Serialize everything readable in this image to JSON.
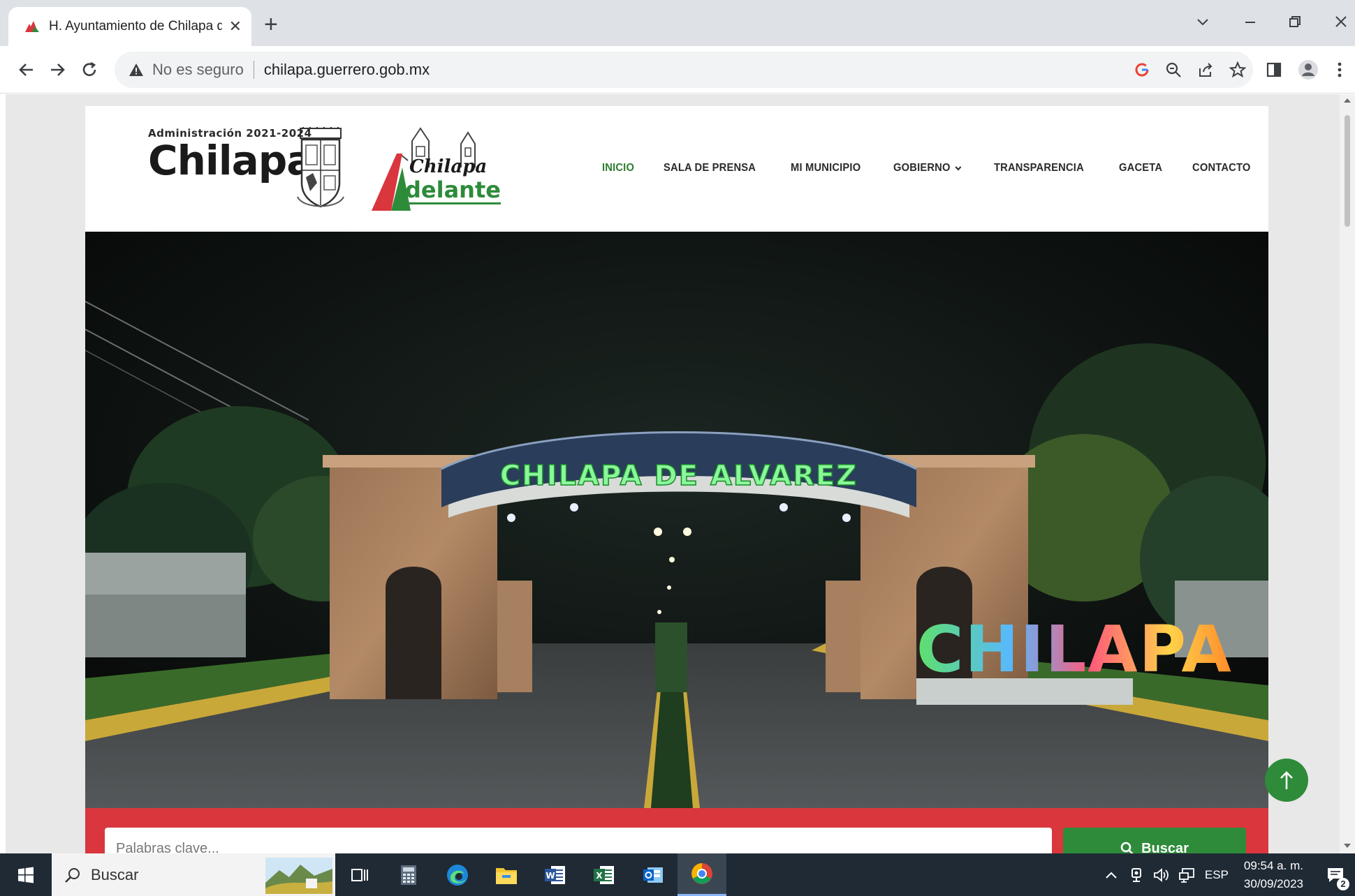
{
  "browser": {
    "tab_title": "H. Ayuntamiento de Chilapa de",
    "new_tab_symbol": "+",
    "security_label": "No es seguro",
    "url": "chilapa.guerrero.gob.mx"
  },
  "site": {
    "administration": "Administración 2021-2024",
    "brand": "Chilapa",
    "slogan_top": "Chilapa",
    "slogan_bottom": "delante",
    "nav": [
      {
        "label": "INICIO",
        "active": true
      },
      {
        "label": "SALA DE PRENSA"
      },
      {
        "label": "MI MUNICIPIO"
      },
      {
        "label": "GOBIERNO"
      },
      {
        "label": "TRANSPARENCIA"
      },
      {
        "label": "GACETA"
      },
      {
        "label": "CONTACTO"
      }
    ],
    "hero": {
      "arch_sign": "CHILAPA  DE  ALVAREZ",
      "letters_sign": "CHILAPA"
    },
    "search": {
      "placeholder": "Palabras clave...",
      "button_label": "Buscar"
    },
    "colors": {
      "accent_green": "#2e8b3a",
      "search_bar_red": "#d9363e"
    }
  },
  "taskbar": {
    "search_label": "Buscar",
    "language": "ESP",
    "time": "09:54 a. m.",
    "date": "30/09/2023",
    "notification_count": "2"
  }
}
